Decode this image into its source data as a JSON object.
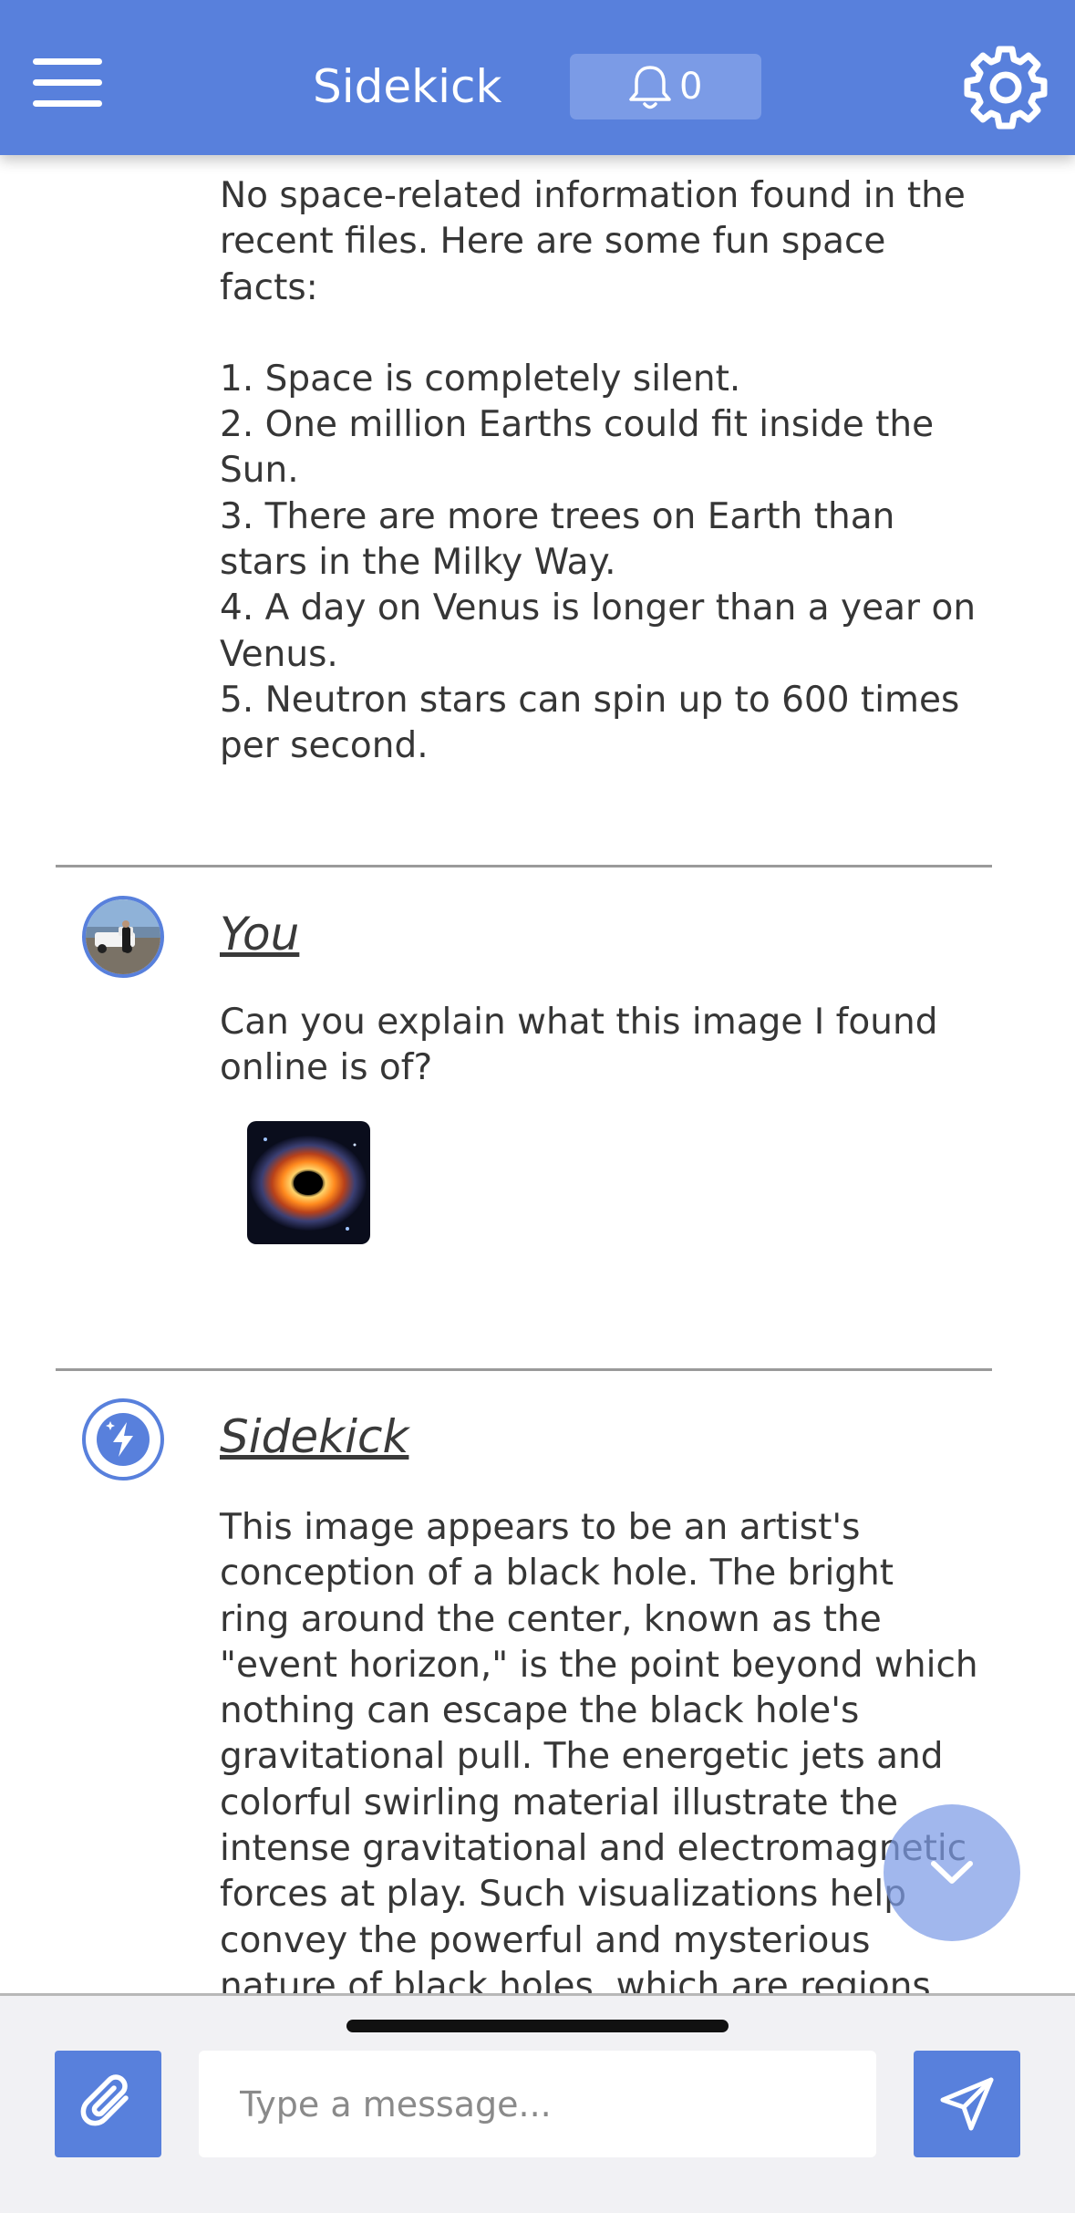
{
  "header": {
    "title": "Sidekick",
    "notification_count": "0"
  },
  "messages": {
    "first": {
      "lines": [
        "No space-related information found in the",
        "recent files. Here are some fun space",
        "facts:",
        "",
        "1. Space is completely silent.",
        "2. One million Earths could fit inside the",
        "Sun.",
        "3. There are more trees on Earth than",
        "stars in the Milky Way.",
        "4. A day on Venus is longer than a year on",
        "Venus.",
        "5. Neutron stars can spin up to 600 times",
        "per second."
      ]
    },
    "user": {
      "sender": "You",
      "lines": [
        "Can you explain what this image I found",
        "online is of?"
      ]
    },
    "assistant": {
      "sender": "Sidekick",
      "lines": [
        "This image appears to be an artist's",
        "conception of a black hole. The bright",
        "ring around the center, known as the",
        "\"event horizon,\" is the point beyond which",
        "nothing can escape the black hole's",
        "gravitational pull. The energetic jets and",
        "colorful swirling material illustrate the",
        "intense gravitational and electromagnetic",
        "forces at play. Such visualizations help",
        "convey the powerful and mysterious",
        "nature of black holes, which are regions"
      ]
    }
  },
  "composer": {
    "placeholder": "Type a message..."
  },
  "colors": {
    "accent": "#5880dc",
    "text": "#363636"
  },
  "icons": {
    "menu": "menu-icon",
    "bell": "bell-icon",
    "settings": "gear-icon",
    "bolt": "lightning-icon",
    "attach": "paperclip-icon",
    "send": "send-icon",
    "scroll": "chevron-down-icon"
  }
}
